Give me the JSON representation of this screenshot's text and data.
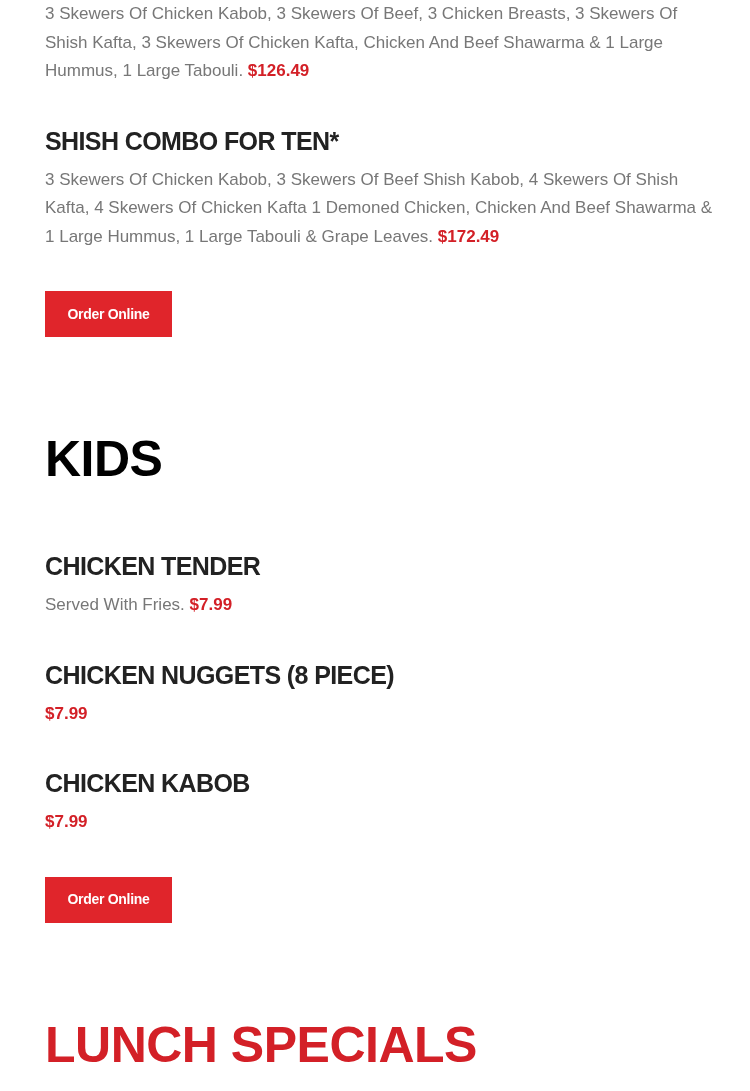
{
  "sections": [
    {
      "items": [
        {
          "description": "3 Skewers Of Chicken Kabob, 3 Skewers Of Beef, 3 Chicken Breasts, 3 Skewers Of Shish Kafta, 3 Skewers Of Chicken Kafta, Chicken And Beef Shawarma & 1 Large Hummus, 1 Large Tabouli.",
          "price": "$126.49"
        },
        {
          "title": "SHISH COMBO FOR TEN*",
          "description": "3 Skewers Of Chicken Kabob, 3 Skewers Of Beef Shish Kabob, 4 Skewers Of Shish Kafta, 4 Skewers Of Chicken Kafta 1 Demoned Chicken, Chicken And Beef Shawarma & 1 Large Hummus, 1 Large Tabouli & Grape Leaves.",
          "price": "$172.49"
        }
      ],
      "button": "Order Online"
    },
    {
      "heading": "KIDS",
      "accent": false,
      "items": [
        {
          "title": "CHICKEN TENDER",
          "description": "Served With Fries.",
          "price": "$7.99"
        },
        {
          "title": "CHICKEN NUGGETS (8 PIECE)",
          "price": "$7.99"
        },
        {
          "title": "CHICKEN KABOB",
          "price": "$7.99"
        }
      ],
      "button": "Order Online"
    },
    {
      "heading": "LUNCH SPECIALS",
      "accent": true
    }
  ]
}
